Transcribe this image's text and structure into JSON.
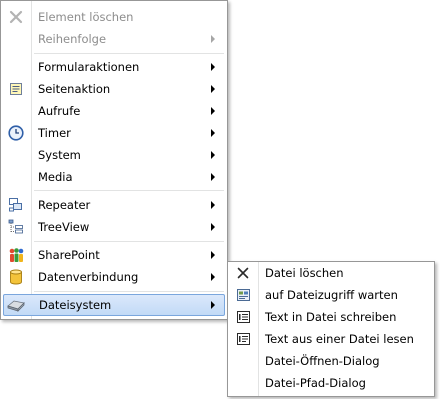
{
  "main_menu": {
    "items": [
      {
        "label": "Element löschen",
        "icon": "delete-x-icon",
        "disabled": true
      },
      {
        "label": "Reihenfolge",
        "disabled": true,
        "submenu": true
      },
      {
        "label": "Formularaktionen",
        "submenu": true
      },
      {
        "label": "Seitenaktion",
        "icon": "page-action-icon",
        "submenu": true
      },
      {
        "label": "Aufrufe",
        "submenu": true
      },
      {
        "label": "Timer",
        "icon": "clock-icon",
        "submenu": true
      },
      {
        "label": "System",
        "submenu": true
      },
      {
        "label": "Media",
        "submenu": true
      },
      {
        "label": "Repeater",
        "icon": "repeater-icon",
        "submenu": true
      },
      {
        "label": "TreeView",
        "icon": "treeview-icon",
        "submenu": true
      },
      {
        "label": "SharePoint",
        "icon": "sharepoint-icon",
        "submenu": true
      },
      {
        "label": "Datenverbindung",
        "icon": "database-icon",
        "submenu": true
      },
      {
        "label": "Dateisystem",
        "icon": "filesystem-icon",
        "submenu": true,
        "highlighted": true
      }
    ]
  },
  "sub_menu": {
    "items": [
      {
        "label": "Datei löschen",
        "icon": "delete-x-icon"
      },
      {
        "label": "auf Dateizugriff warten",
        "icon": "wait-file-icon"
      },
      {
        "label": "Text in Datei schreiben",
        "icon": "write-text-icon"
      },
      {
        "label": "Text aus einer Datei lesen",
        "icon": "read-text-icon"
      },
      {
        "label": "Datei-Öffnen-Dialog"
      },
      {
        "label": "Datei-Pfad-Dialog"
      }
    ]
  },
  "colors": {
    "highlight_border": "#7aa6dd",
    "highlight_fill": "#c2daf6",
    "disabled_text": "#8d8d8d"
  }
}
